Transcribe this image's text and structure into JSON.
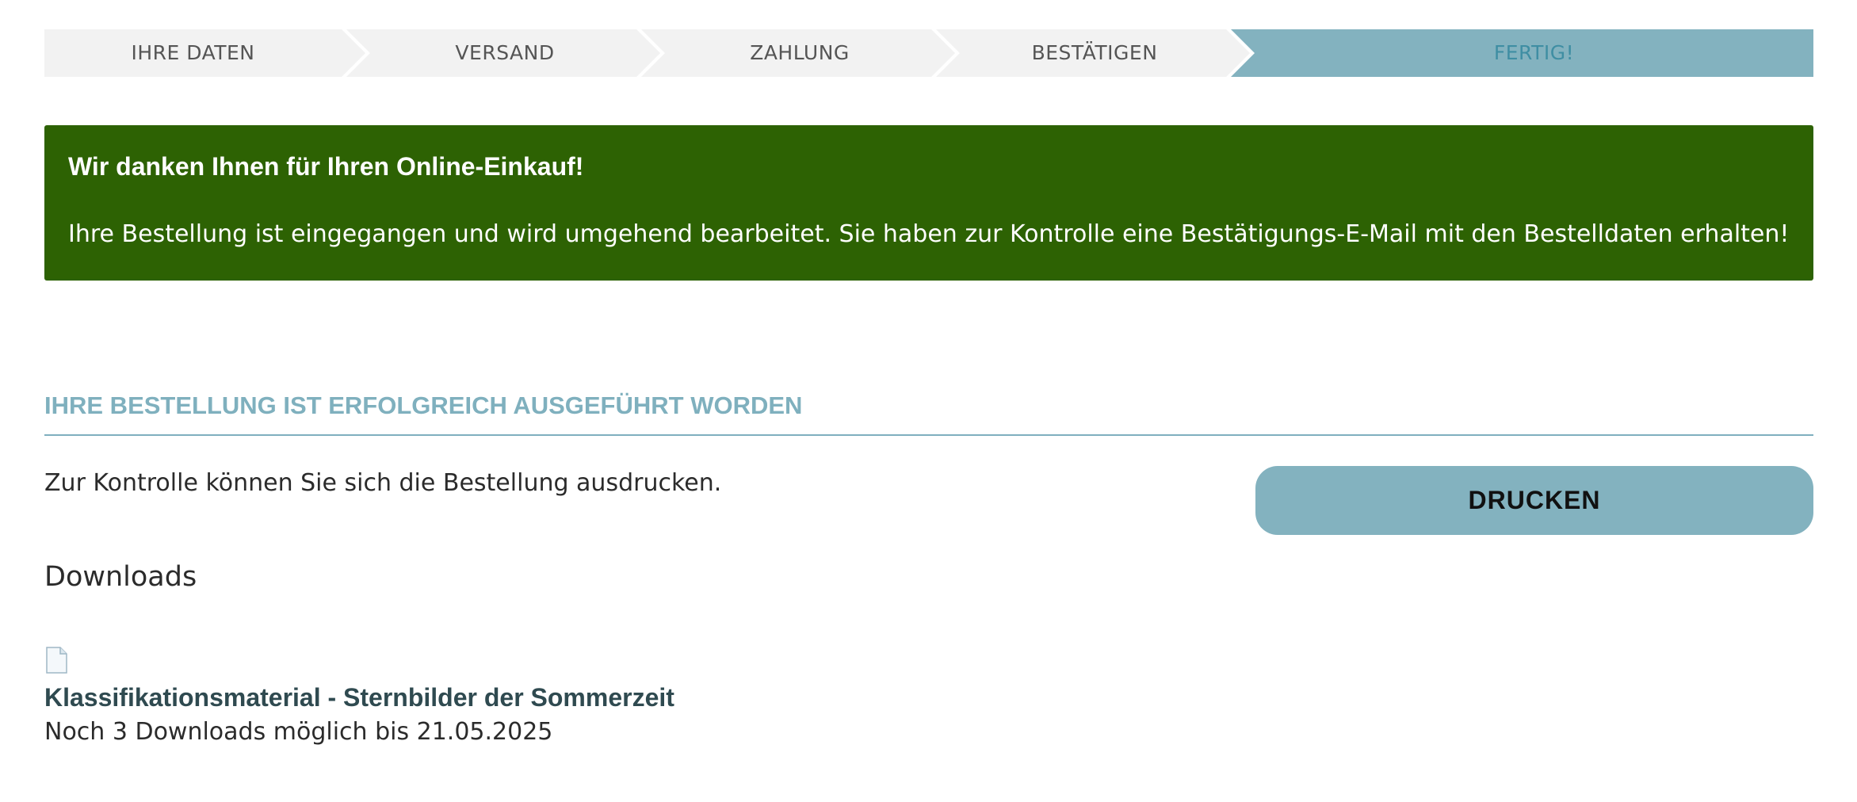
{
  "checkout_steps": [
    {
      "label": "IHRE DATEN",
      "state": "inactive"
    },
    {
      "label": "VERSAND",
      "state": "inactive"
    },
    {
      "label": "ZAHLUNG",
      "state": "inactive"
    },
    {
      "label": "BESTÄTIGEN",
      "state": "inactive"
    },
    {
      "label": "FERTIG!",
      "state": "active"
    }
  ],
  "alert": {
    "title": "Wir danken Ihnen für Ihren Online-Einkauf!",
    "text": "Ihre Bestellung ist eingegangen und wird umgehend bearbeitet. Sie haben zur Kontrolle eine Bestätigungs-E-Mail mit den Bestelldaten erhalten!"
  },
  "order": {
    "section_title": "IHRE BESTELLUNG IST ERFOLGREICH AUSGEFÜHRT WORDEN",
    "info_text": "Zur Kontrolle können Sie sich die Bestellung ausdrucken.",
    "print_label": "DRUCKEN"
  },
  "downloads": {
    "heading": "Downloads",
    "items": [
      {
        "icon": "file-icon",
        "title": "Klassifikationsmaterial - Sternbilder der Sommerzeit",
        "meta": "Noch 3 Downloads möglich bis 21.05.2025"
      }
    ]
  },
  "colors": {
    "step_inactive_bg": "#f2f2f2",
    "step_active_bg": "#83b2bf",
    "step_active_text": "#3f8ea3",
    "alert_bg": "#2d6203",
    "accent": "#7fb0be",
    "button_bg": "#83b2bf"
  }
}
